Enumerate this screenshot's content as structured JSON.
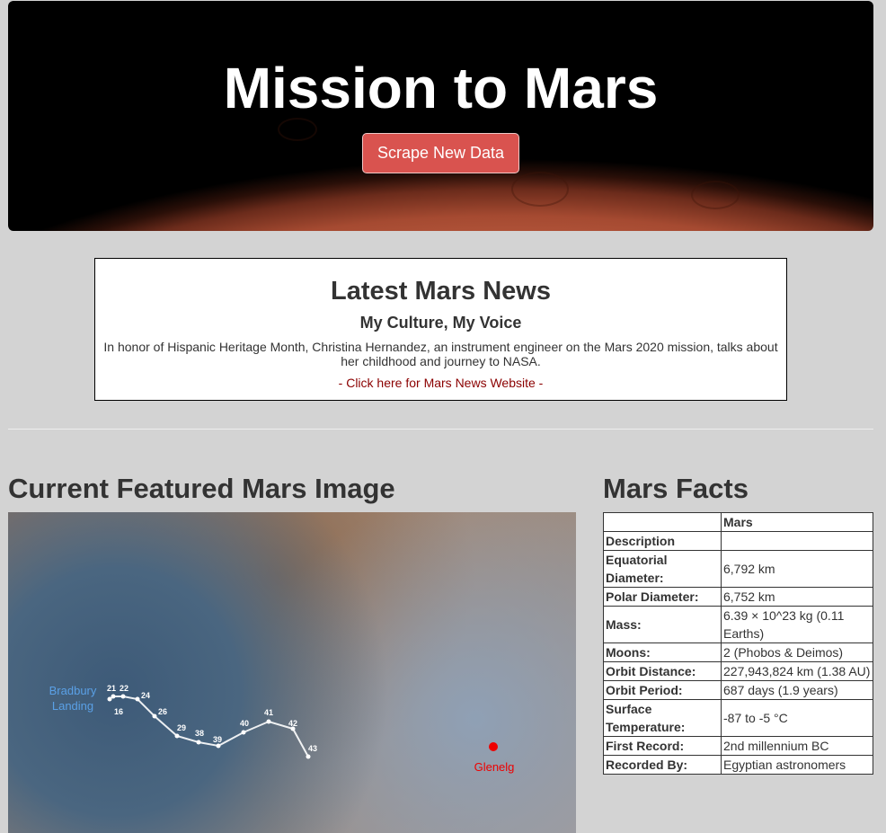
{
  "hero": {
    "title": "Mission to Mars",
    "button_label": "Scrape New Data"
  },
  "news": {
    "heading": "Latest Mars News",
    "title": "My Culture, My Voice",
    "paragraph": "In honor of Hispanic Heritage Month, Christina Hernandez, an instrument engineer on the Mars 2020 mission, talks about her childhood and journey to NASA.",
    "link_text": "- Click here for Mars News Website -"
  },
  "featured": {
    "heading": "Current Featured Mars Image",
    "labels": {
      "landing": [
        "Bradbury",
        "Landing"
      ],
      "glenelg": "Glenelg"
    },
    "waypoints": [
      "21",
      "22",
      "24",
      "16",
      "26",
      "29",
      "38",
      "39",
      "40",
      "41",
      "42",
      "43"
    ]
  },
  "facts": {
    "heading": "Mars Facts",
    "header": [
      "",
      "Mars"
    ],
    "rows": [
      [
        "Description",
        ""
      ],
      [
        "Equatorial Diameter:",
        "6,792 km"
      ],
      [
        "Polar Diameter:",
        "6,752 km"
      ],
      [
        "Mass:",
        "6.39 × 10^23 kg (0.11 Earths)"
      ],
      [
        "Moons:",
        "2 (Phobos & Deimos)"
      ],
      [
        "Orbit Distance:",
        "227,943,824 km (1.38 AU)"
      ],
      [
        "Orbit Period:",
        "687 days (1.9 years)"
      ],
      [
        "Surface Temperature:",
        "-87 to -5 °C"
      ],
      [
        "First Record:",
        "2nd millennium BC"
      ],
      [
        "Recorded By:",
        "Egyptian astronomers"
      ]
    ]
  },
  "colors": {
    "accent": "#d9534f",
    "link": "#8b0000",
    "page_bg": "#d3d3d3"
  }
}
